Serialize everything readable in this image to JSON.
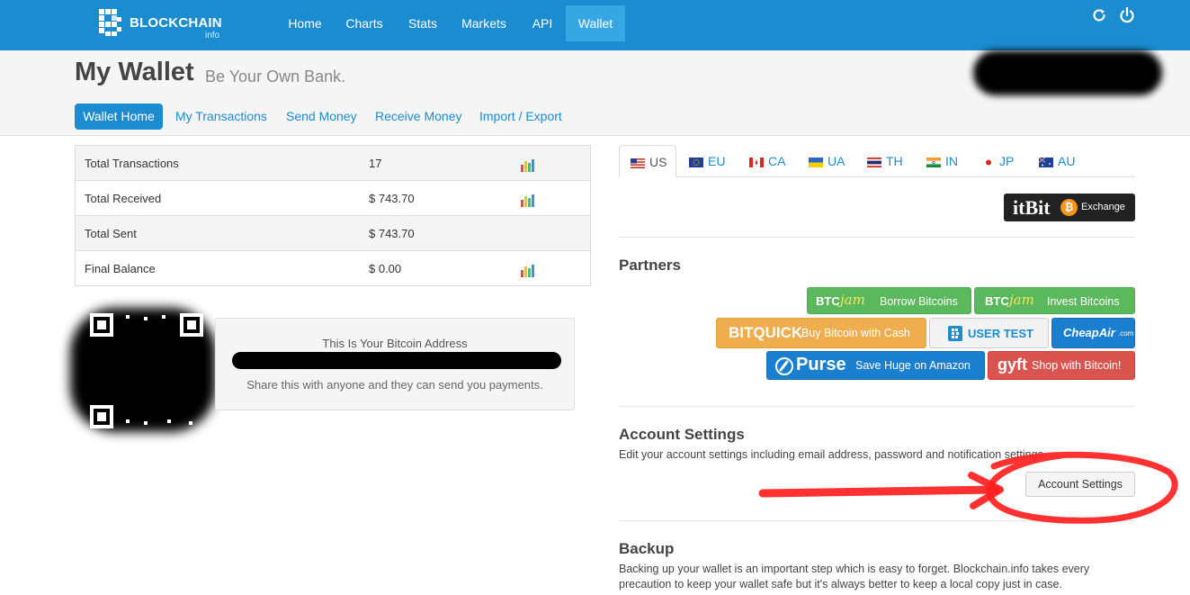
{
  "brand": {
    "name": "BLOCKCHAIN",
    "sub": "info"
  },
  "nav": {
    "items": [
      "Home",
      "Charts",
      "Stats",
      "Markets",
      "API",
      "Wallet"
    ],
    "active": "Wallet"
  },
  "header": {
    "title": "My Wallet",
    "subtitle": "Be Your Own Bank."
  },
  "subnav": {
    "items": [
      "Wallet Home",
      "My Transactions",
      "Send Money",
      "Receive Money",
      "Import / Export"
    ],
    "active": "Wallet Home"
  },
  "stats": [
    {
      "label": "Total Transactions",
      "value": "17"
    },
    {
      "label": "Total Received",
      "value": "$ 743.70"
    },
    {
      "label": "Total Sent",
      "value": "$ 743.70"
    },
    {
      "label": "Final Balance",
      "value": "$ 0.00"
    }
  ],
  "address": {
    "title": "This Is Your Bitcoin Address",
    "hint": "Share this with anyone and they can send you payments."
  },
  "currencies": [
    "US",
    "EU",
    "CA",
    "UA",
    "TH",
    "IN",
    "JP",
    "AU"
  ],
  "exchange": {
    "brand": "itBit",
    "coin": "₿",
    "label": "Exchange"
  },
  "partners": {
    "title": "Partners",
    "btcjam_brand_a": "BTC",
    "btcjam_brand_b": "jam",
    "btcjam_borrow": "Borrow Bitcoins",
    "btcjam_invest": "Invest Bitcoins",
    "bitquick_brand": "BITQUICK",
    "bitquick_text": "Buy Bitcoin with Cash",
    "usertest_text": "USER TEST",
    "cheapair_brand": "CheapAir",
    "cheapair_suffix": ".com",
    "purse_brand": "Purse",
    "purse_text": "Save Huge on Amazon",
    "gyft_brand": "gyft",
    "gyft_text": "Shop with Bitcoin!"
  },
  "account": {
    "title": "Account Settings",
    "text": "Edit your account settings including email address, password and notification settings.",
    "button": "Account Settings"
  },
  "backup": {
    "title": "Backup",
    "text_line1": "Backing up your wallet is an important step which is easy to forget. Blockchain.info takes every",
    "text_line2": "precaution to keep your wallet safe but it's always better to keep a local copy just in case."
  }
}
